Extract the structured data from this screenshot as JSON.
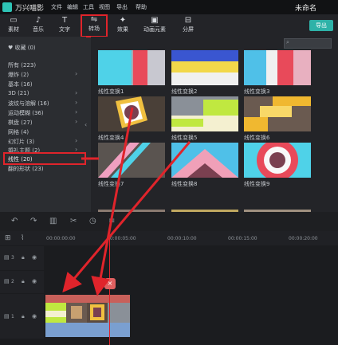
{
  "titlebar": {
    "app_title": "万兴喵影",
    "menus": [
      "文件",
      "编辑",
      "工具",
      "视图",
      "导出",
      "帮助"
    ],
    "doc_title": "未命名"
  },
  "toolbar": {
    "items": [
      {
        "icon": "folder-icon",
        "label": "素材"
      },
      {
        "icon": "music-icon",
        "label": "音乐"
      },
      {
        "icon": "text-icon",
        "label": "文字"
      },
      {
        "icon": "transition-icon",
        "label": "转场"
      },
      {
        "icon": "effects-icon",
        "label": "效果"
      },
      {
        "icon": "elements-icon",
        "label": "动画元素"
      },
      {
        "icon": "split-icon",
        "label": "分屏"
      }
    ],
    "export_label": "导出"
  },
  "left_panel": {
    "favorites": "收藏 (0)",
    "categories": [
      "所有 (223)",
      "爆炸 (2)",
      "基本 (16)",
      "3D (21)",
      "波纹与溶解 (16)",
      "运动模糊 (36)",
      "棋盘 (27)",
      "网格 (4)",
      "幻灯片 (3)",
      "婚礼主题 (2)",
      "线性 (20)",
      "翻的形状 (23)"
    ]
  },
  "grid": {
    "items": [
      "线性变换1",
      "线性变换2",
      "线性变换3",
      "线性变换4",
      "线性变换5",
      "线性变换6",
      "线性变换7",
      "线性变换8",
      "线性变换9"
    ]
  },
  "timeline": {
    "timecodes": [
      "00:00:00:00",
      "00:00:05:00",
      "00:00:10:00",
      "00:00:15:00",
      "00:00:20:00"
    ],
    "tracks": [
      "3",
      "2",
      "1"
    ],
    "playhead_close": "×"
  }
}
